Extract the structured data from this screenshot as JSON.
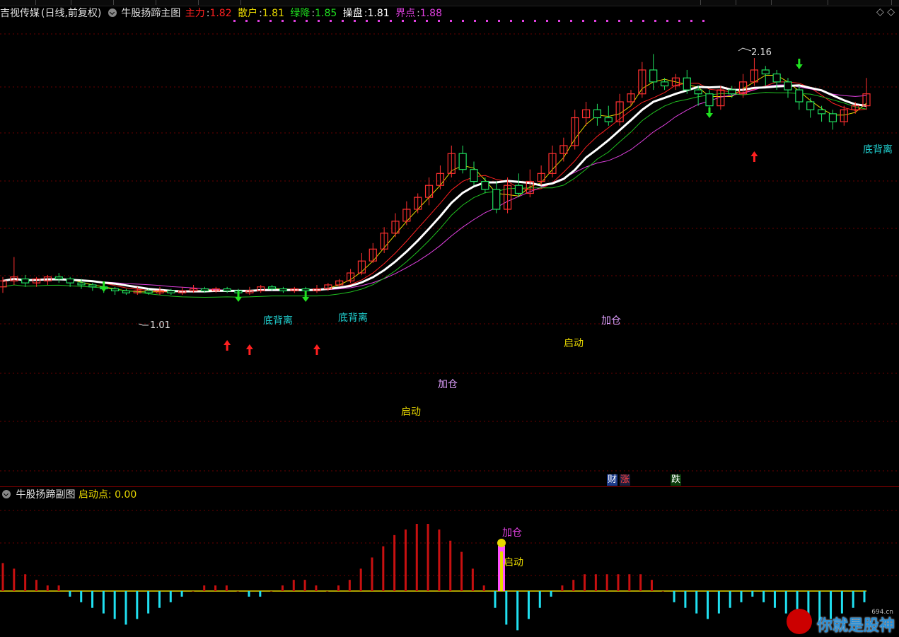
{
  "header": {
    "stock_name": "吉视传媒",
    "period": "(日线,前复权)",
    "indicator": "牛股扬蹄主图",
    "items": [
      {
        "label": "主力",
        "value": "1.82",
        "color": "#ff2020"
      },
      {
        "label": "散户",
        "value": "1.81",
        "color": "#e8d800"
      },
      {
        "label": "绿降",
        "value": "1.85",
        "color": "#20e020"
      },
      {
        "label": "操盘",
        "value": "1.81",
        "color": "#ffffff"
      },
      {
        "label": "界点",
        "value": "1.88",
        "color": "#e040e0"
      }
    ],
    "corner_icons": "◇ ◇"
  },
  "sub": {
    "indicator": "牛股扬蹄副图",
    "label": "启动点",
    "value": "0.00"
  },
  "tags": [
    {
      "text": "财",
      "bg": "#1e3c8c",
      "fg": "#ffffff"
    },
    {
      "text": "涨",
      "bg": "#1e1e3c",
      "fg": "#ff4040"
    },
    {
      "text": "跌",
      "bg": "#0a3c0a",
      "fg": "#ffffff"
    }
  ],
  "annotations": {
    "high": "2.16",
    "low": "1.01",
    "divergence": "底背离",
    "start": "启动",
    "add": "加仓"
  },
  "watermark": {
    "text": "你就是股神",
    "site": "694.cn"
  },
  "colors": {
    "up": "#ff3030",
    "down": "#20e0e0",
    "bg": "#000000",
    "grid": "#7a0000"
  },
  "chart_data": {
    "type": "candlestick",
    "ylim": [
      0.9,
      2.25
    ],
    "candles": [
      [
        1.05,
        1.08,
        1.02,
        1.1
      ],
      [
        1.08,
        1.1,
        1.06,
        1.2
      ],
      [
        1.09,
        1.07,
        1.05,
        1.11
      ],
      [
        1.07,
        1.09,
        1.05,
        1.1
      ],
      [
        1.08,
        1.1,
        1.06,
        1.11
      ],
      [
        1.1,
        1.09,
        1.07,
        1.12
      ],
      [
        1.09,
        1.07,
        1.05,
        1.1
      ],
      [
        1.07,
        1.06,
        1.04,
        1.09
      ],
      [
        1.06,
        1.05,
        1.03,
        1.07
      ],
      [
        1.05,
        1.04,
        1.02,
        1.06
      ],
      [
        1.04,
        1.03,
        1.01,
        1.05
      ],
      [
        1.03,
        1.02,
        1.01,
        1.04
      ],
      [
        1.02,
        1.03,
        1.01,
        1.05
      ],
      [
        1.03,
        1.02,
        1.01,
        1.04
      ],
      [
        1.02,
        1.03,
        1.01,
        1.05
      ],
      [
        1.03,
        1.02,
        1.01,
        1.04
      ],
      [
        1.02,
        1.03,
        1.01,
        1.05
      ],
      [
        1.03,
        1.04,
        1.02,
        1.06
      ],
      [
        1.04,
        1.03,
        1.02,
        1.05
      ],
      [
        1.03,
        1.04,
        1.02,
        1.05
      ],
      [
        1.04,
        1.03,
        1.02,
        1.05
      ],
      [
        1.03,
        1.02,
        1.01,
        1.04
      ],
      [
        1.02,
        1.03,
        1.01,
        1.05
      ],
      [
        1.03,
        1.05,
        1.02,
        1.06
      ],
      [
        1.05,
        1.04,
        1.03,
        1.06
      ],
      [
        1.04,
        1.03,
        1.02,
        1.05
      ],
      [
        1.03,
        1.04,
        1.02,
        1.05
      ],
      [
        1.04,
        1.03,
        1.02,
        1.05
      ],
      [
        1.03,
        1.04,
        1.02,
        1.06
      ],
      [
        1.04,
        1.06,
        1.03,
        1.07
      ],
      [
        1.06,
        1.08,
        1.05,
        1.09
      ],
      [
        1.08,
        1.12,
        1.07,
        1.14
      ],
      [
        1.12,
        1.18,
        1.11,
        1.22
      ],
      [
        1.18,
        1.24,
        1.17,
        1.27
      ],
      [
        1.24,
        1.32,
        1.22,
        1.35
      ],
      [
        1.32,
        1.38,
        1.3,
        1.42
      ],
      [
        1.38,
        1.44,
        1.36,
        1.48
      ],
      [
        1.44,
        1.5,
        1.42,
        1.52
      ],
      [
        1.5,
        1.56,
        1.46,
        1.6
      ],
      [
        1.56,
        1.62,
        1.54,
        1.66
      ],
      [
        1.62,
        1.72,
        1.6,
        1.76
      ],
      [
        1.72,
        1.64,
        1.62,
        1.76
      ],
      [
        1.64,
        1.58,
        1.56,
        1.68
      ],
      [
        1.58,
        1.54,
        1.52,
        1.6
      ],
      [
        1.54,
        1.44,
        1.42,
        1.58
      ],
      [
        1.44,
        1.56,
        1.42,
        1.6
      ],
      [
        1.56,
        1.52,
        1.5,
        1.62
      ],
      [
        1.52,
        1.58,
        1.5,
        1.64
      ],
      [
        1.58,
        1.62,
        1.56,
        1.66
      ],
      [
        1.62,
        1.72,
        1.6,
        1.76
      ],
      [
        1.72,
        1.76,
        1.68,
        1.8
      ],
      [
        1.76,
        1.9,
        1.74,
        1.94
      ],
      [
        1.9,
        1.94,
        1.86,
        1.98
      ],
      [
        1.94,
        1.9,
        1.86,
        1.97
      ],
      [
        1.9,
        1.88,
        1.86,
        1.96
      ],
      [
        1.88,
        1.98,
        1.86,
        2.02
      ],
      [
        1.98,
        2.02,
        1.96,
        2.04
      ],
      [
        2.02,
        2.14,
        2.0,
        2.18
      ],
      [
        2.14,
        2.08,
        2.04,
        2.22
      ],
      [
        2.08,
        2.06,
        2.04,
        2.1
      ],
      [
        2.06,
        2.1,
        2.04,
        2.12
      ],
      [
        2.1,
        2.04,
        2.02,
        2.14
      ],
      [
        2.04,
        2.02,
        1.96,
        2.06
      ],
      [
        2.02,
        1.96,
        1.94,
        2.04
      ],
      [
        1.96,
        2.04,
        1.94,
        2.06
      ],
      [
        2.04,
        2.02,
        2.0,
        2.06
      ],
      [
        2.02,
        2.08,
        2.0,
        2.12
      ],
      [
        2.08,
        2.14,
        2.06,
        2.2
      ],
      [
        2.14,
        2.12,
        2.06,
        2.16
      ],
      [
        2.12,
        2.08,
        2.04,
        2.14
      ],
      [
        2.08,
        2.04,
        2.0,
        2.1
      ],
      [
        2.04,
        1.98,
        1.94,
        2.06
      ],
      [
        1.98,
        1.94,
        1.9,
        2.0
      ],
      [
        1.94,
        1.92,
        1.88,
        1.96
      ],
      [
        1.92,
        1.88,
        1.84,
        1.94
      ],
      [
        1.88,
        1.94,
        1.86,
        1.96
      ],
      [
        1.94,
        1.96,
        1.92,
        1.98
      ],
      [
        1.96,
        2.02,
        1.94,
        2.1
      ]
    ],
    "macd": [
      0.05,
      0.04,
      0.03,
      0.02,
      0.01,
      0.01,
      -0.01,
      -0.02,
      -0.03,
      -0.04,
      -0.05,
      -0.06,
      -0.05,
      -0.04,
      -0.03,
      -0.02,
      -0.01,
      0.0,
      0.01,
      0.01,
      0.01,
      0.0,
      -0.01,
      -0.01,
      0.0,
      0.01,
      0.02,
      0.02,
      0.01,
      0.0,
      0.01,
      0.02,
      0.04,
      0.06,
      0.08,
      0.1,
      0.11,
      0.12,
      0.12,
      0.11,
      0.09,
      0.07,
      0.04,
      0.01,
      -0.03,
      -0.06,
      -0.07,
      -0.05,
      -0.03,
      -0.01,
      0.01,
      0.02,
      0.03,
      0.03,
      0.03,
      0.03,
      0.03,
      0.03,
      0.02,
      0.0,
      -0.02,
      -0.03,
      -0.04,
      -0.05,
      -0.04,
      -0.03,
      -0.02,
      -0.01,
      -0.02,
      -0.03,
      -0.04,
      -0.05,
      -0.06,
      -0.06,
      -0.05,
      -0.04,
      -0.03,
      -0.02
    ]
  }
}
